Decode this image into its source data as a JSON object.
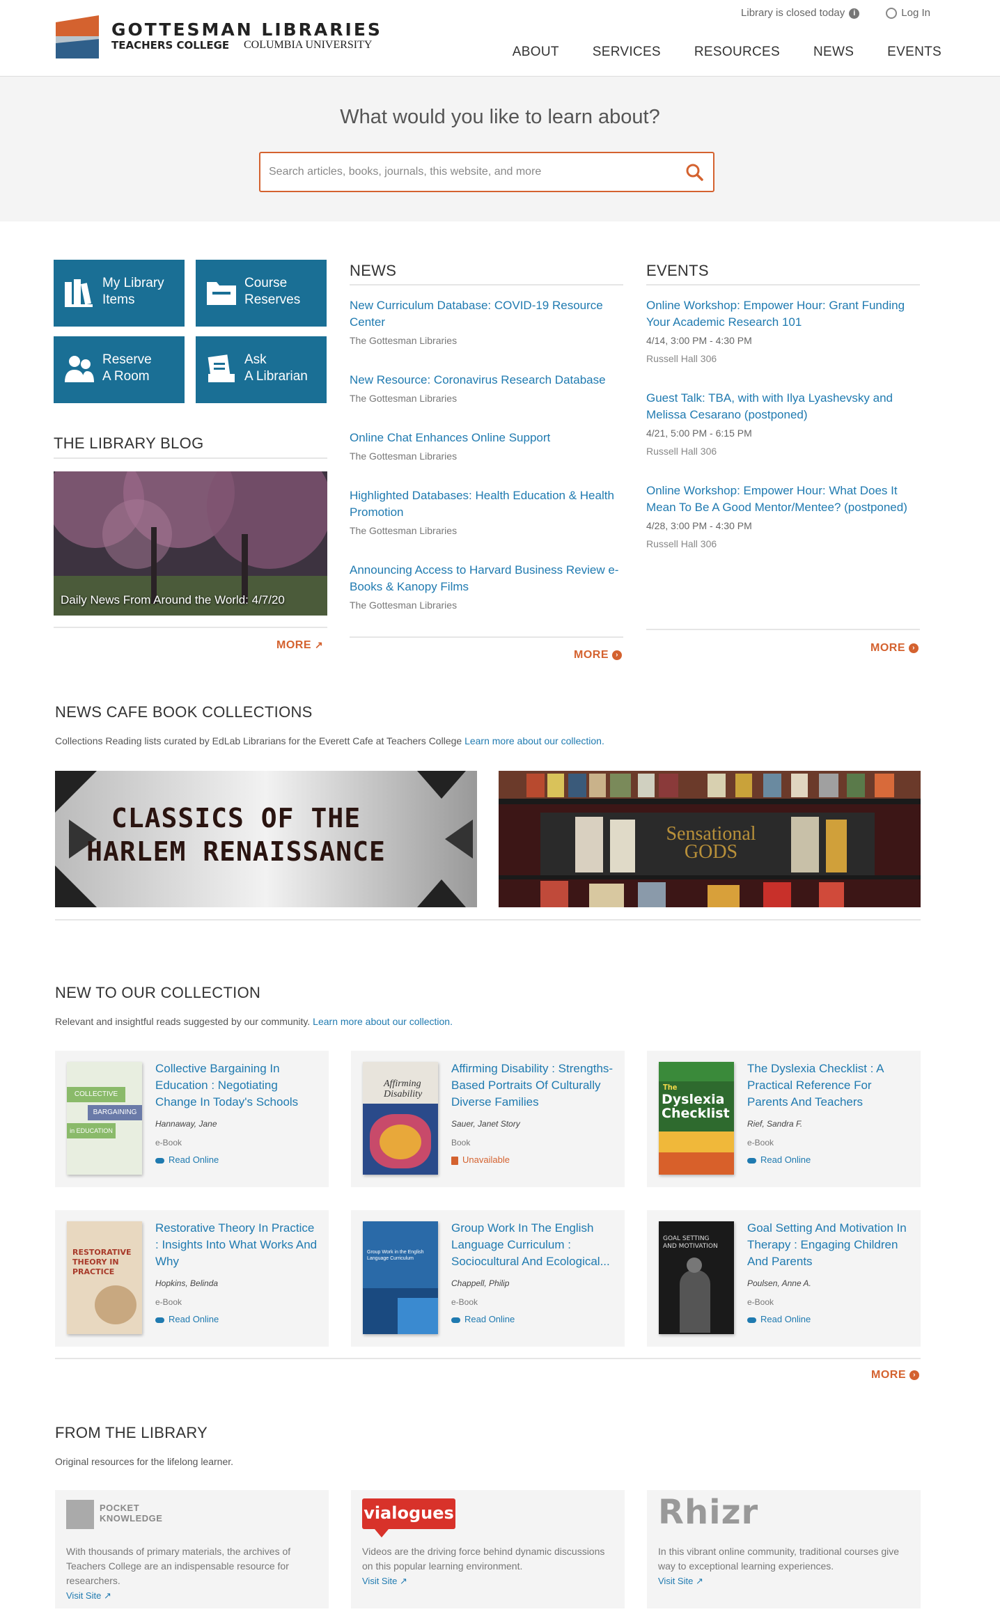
{
  "header": {
    "logo_line1": "GOTTESMAN LIBRARIES",
    "logo_line2": "TEACHERS COLLEGE",
    "logo_line3": "COLUMBIA UNIVERSITY",
    "status": "Library is closed today",
    "login": "Log In",
    "nav": [
      "ABOUT",
      "SERVICES",
      "RESOURCES",
      "NEWS",
      "EVENTS"
    ]
  },
  "search": {
    "question": "What would you like to learn about?",
    "placeholder": "Search articles, books, journals, this website, and more"
  },
  "tiles": [
    {
      "line1": "My Library",
      "line2": "Items"
    },
    {
      "line1": "Course",
      "line2": "Reserves"
    },
    {
      "line1": "Reserve",
      "line2": "A Room"
    },
    {
      "line1": "Ask",
      "line2": "A Librarian"
    }
  ],
  "blog": {
    "heading": "THE LIBRARY BLOG",
    "caption": "Daily News From Around the World: 4/7/20",
    "more": "MORE"
  },
  "news": {
    "heading": "NEWS",
    "items": [
      {
        "title": "New Curriculum Database: COVID-19 Resource Center",
        "source": "The Gottesman Libraries"
      },
      {
        "title": "New Resource: Coronavirus Research Database",
        "source": "The Gottesman Libraries"
      },
      {
        "title": "Online Chat Enhances Online Support",
        "source": "The Gottesman Libraries"
      },
      {
        "title": "Highlighted Databases: Health Education & Health Promotion",
        "source": "The Gottesman Libraries"
      },
      {
        "title": "Announcing Access to Harvard Business Review e-Books & Kanopy Films",
        "source": "The Gottesman Libraries"
      }
    ],
    "more": "MORE"
  },
  "events": {
    "heading": "EVENTS",
    "items": [
      {
        "title": "Online Workshop: Empower Hour: Grant Funding Your Academic Research 101",
        "date": "4/14, 3:00 PM - 4:30 PM",
        "location": "Russell Hall 306"
      },
      {
        "title": "Guest Talk: TBA, with with Ilya Lyashevsky and Melissa Cesarano (postponed)",
        "date": "4/21, 5:00 PM - 6:15 PM",
        "location": "Russell Hall 306"
      },
      {
        "title": "Online Workshop: Empower Hour: What Does It Mean To Be A Good Mentor/Mentee? (postponed)",
        "date": "4/28, 3:00 PM - 4:30 PM",
        "location": "Russell Hall 306"
      }
    ],
    "more": "MORE"
  },
  "cafe": {
    "heading": "NEWS CAFE BOOK COLLECTIONS",
    "subtext": "Collections Reading lists curated by EdLab Librarians for the Everett Cafe at Teachers College",
    "link": "Learn more about our collection.",
    "banner1_line1": "CLASSICS OF THE",
    "banner1_line2": "HARLEM RENAISSANCE",
    "banner2_label": "Sensational GODS"
  },
  "collection": {
    "heading": "NEW TO OUR COLLECTION",
    "subtext": "Relevant and insightful reads suggested by our community.",
    "link": "Learn more about our collection.",
    "more": "MORE",
    "books": [
      {
        "title": "Collective Bargaining In Education : Negotiating Change In Today's Schools",
        "author": "Hannaway, Jane",
        "format": "e-Book",
        "availability": "Read Online",
        "cover_text": "COLLECTIVE BARGAINING in EDUCATION"
      },
      {
        "title": "Affirming Disability : Strengths-Based Portraits Of Culturally Diverse Families",
        "author": "Sauer, Janet Story",
        "format": "Book",
        "availability": "Unavailable",
        "cover_text": "Affirming Disability"
      },
      {
        "title": "The Dyslexia Checklist : A Practical Reference For Parents And Teachers",
        "author": "Rief, Sandra F.",
        "format": "e-Book",
        "availability": "Read Online",
        "cover_text": "The Dyslexia Checklist"
      },
      {
        "title": "Restorative Theory In Practice : Insights Into What Works And Why",
        "author": "Hopkins, Belinda",
        "format": "e-Book",
        "availability": "Read Online",
        "cover_text": "RESTORATIVE THEORY IN PRACTICE"
      },
      {
        "title": "Group Work In The English Language Curriculum : Sociocultural And Ecological...",
        "author": "Chappell, Philip",
        "format": "e-Book",
        "availability": "Read Online",
        "cover_text": "Group Work in the English Language Curriculum"
      },
      {
        "title": "Goal Setting And Motivation In Therapy : Engaging Children And Parents",
        "author": "Poulsen, Anne A.",
        "format": "e-Book",
        "availability": "Read Online",
        "cover_text": "GOAL SETTING AND MOTIVATION"
      }
    ]
  },
  "from_library": {
    "heading": "FROM THE LIBRARY",
    "subtext": "Original resources for the lifelong learner.",
    "items": [
      {
        "logo": "POCKET KNOWLEDGE",
        "desc": "With thousands of primary materials, the archives of Teachers College are an indispensable resource for researchers.",
        "visit": "Visit Site"
      },
      {
        "logo": "vialogues",
        "desc": "Videos are the driving force behind dynamic discussions on this popular learning environment.",
        "visit": "Visit Site"
      },
      {
        "logo": "Rhizr",
        "desc": "In this vibrant online community, traditional courses give way to exceptional learning experiences.",
        "visit": "Visit Site"
      }
    ]
  },
  "colors": {
    "accent": "#d4622f",
    "tile": "#1a6f95",
    "link": "#1f7ab0"
  }
}
